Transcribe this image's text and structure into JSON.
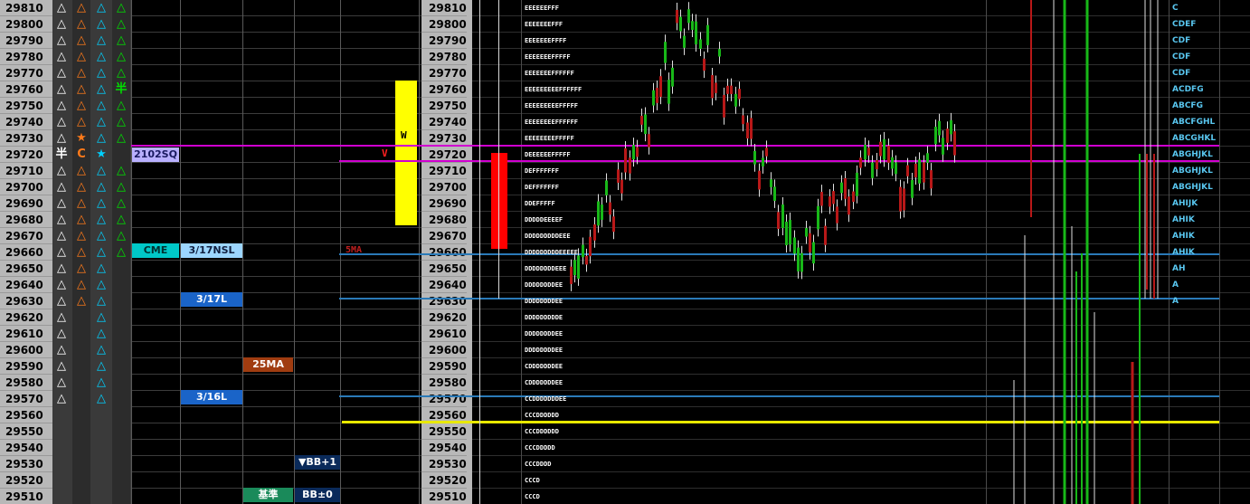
{
  "prices": [
    "29810",
    "29800",
    "29790",
    "29780",
    "29770",
    "29760",
    "29750",
    "29740",
    "29730",
    "29720",
    "29710",
    "29700",
    "29690",
    "29680",
    "29670",
    "29660",
    "29650",
    "29640",
    "29630",
    "29620",
    "29610",
    "29600",
    "29590",
    "29580",
    "29570",
    "29560",
    "29550",
    "29540",
    "29530",
    "29520",
    "29510"
  ],
  "signals": {
    "col1": [
      "△",
      "△",
      "△",
      "△",
      "△",
      "△",
      "△",
      "△",
      "△",
      "半",
      "△",
      "△",
      "△",
      "△",
      "△",
      "△",
      "△",
      "△",
      "△",
      "△",
      "△",
      "△",
      "△",
      "△",
      "△",
      "",
      "",
      "",
      "",
      "",
      ""
    ],
    "col2": [
      "△",
      "△",
      "△",
      "△",
      "△",
      "△",
      "△",
      "△",
      "★",
      "C",
      "△",
      "△",
      "△",
      "△",
      "△",
      "△",
      "△",
      "△",
      "△",
      "",
      "",
      "",
      "",
      "",
      "",
      "",
      "",
      "",
      "",
      "",
      ""
    ],
    "col3": [
      "△",
      "△",
      "△",
      "△",
      "△",
      "△",
      "△",
      "△",
      "△",
      "★",
      "△",
      "△",
      "△",
      "△",
      "△",
      "△",
      "△",
      "△",
      "△",
      "△",
      "△",
      "△",
      "△",
      "△",
      "△",
      "",
      "",
      "",
      "",
      "",
      ""
    ],
    "col4": [
      "△",
      "△",
      "△",
      "△",
      "△",
      "半",
      "△",
      "△",
      "△",
      "",
      "△",
      "△",
      "△",
      "△",
      "△",
      "△",
      "",
      "",
      "",
      "",
      "",
      "",
      "",
      "",
      "",
      "",
      "",
      "",
      "",
      "",
      ""
    ]
  },
  "badges": {
    "sq": "2102SQ",
    "cme": "CME",
    "nsl": "3/17NSL",
    "l317": "3/17L",
    "l316": "3/16L",
    "ma25": "25MA",
    "bb1": "▼BB+1",
    "kijun": "基準",
    "bb0": "BB±0",
    "v": "V",
    "w": "W",
    "ma5": "5MA"
  },
  "tpo": [
    "EEEEEEFFF",
    "EEEEEEEFFF",
    "EEEEEEEFFFF",
    "EEEEEEEFFFFF",
    "EEEEEEEFFFFFF",
    "EEEEEEEEEFFFFFF",
    "EEEEEEEEEFFFFF",
    "EEEEEEEEFFFFFF",
    "EEEEEEEEFFFFF",
    "DEEEEEEFFFFF",
    "DEFFFFFFF",
    "DEFFFFFFF",
    "DDEFFFFF",
    "DDDDDEEEEF",
    "DDDDDDDDDEEE",
    "DDDDDDDDDEEEEE",
    "DDDDDDDDEEE",
    "DDDDDDDDEE",
    "DDDDDDDDEE",
    "DDDDDDDDDE",
    "DDDDDDDDEE",
    "DDDDDDDDEE",
    "CDDDDDDDEE",
    "CDDDDDDDEE",
    "CCDDDDDDDEE",
    "CCCDDDDDD",
    "CCCDDDDDD",
    "CCCDDDDD",
    "CCCDDDD",
    "CCCD",
    "CCCD"
  ],
  "right_letters": [
    "C",
    "CDEF",
    "CDF",
    "CDF",
    "CDF",
    "ACDFG",
    "ABCFG",
    "ABCFGHL",
    "ABCGHKL",
    "ABGHJKL",
    "ABGHJKL",
    "ABGHJKL",
    "AHIJK",
    "AHIK",
    "AHIK",
    "AHIK",
    "AH",
    "A",
    "A",
    "",
    "",
    "",
    "",
    "",
    "",
    "",
    "",
    "",
    "",
    "",
    ""
  ],
  "colors": {
    "price_bg": "#b8b8b8",
    "triangle_white": "#ffffff",
    "triangle_orange": "#ff7a1a",
    "triangle_cyan": "#00d0ff",
    "triangle_green": "#00e000",
    "sq_badge": "#b9b0ff",
    "cme_badge": "#00c8c8",
    "nsl_badge": "#9cd6ff",
    "l_badge": "#1a64c8",
    "ma25_badge": "#a03c10",
    "bb_badge": "#0a2a5a",
    "kijun_badge": "#1a8a5a",
    "magenta_line": "#d000d0",
    "blue_line": "#2a7ab8",
    "yellow_line": "#e8e800",
    "candle_up": "#18b818",
    "candle_down": "#b81818"
  }
}
